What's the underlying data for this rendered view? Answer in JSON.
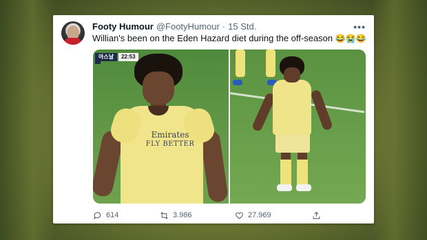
{
  "tweet": {
    "display_name": "Footy Humour",
    "handle": "@FootyHumour",
    "separator": "·",
    "time": "15 Std.",
    "more_label": "•••",
    "text": "Willian's been on the Eden Hazard diet during the off-season",
    "emojis": "😂😭😂"
  },
  "media": {
    "scorebug_team": "아스날",
    "scorebug_clock": "22:53",
    "sponsor_line1": "Emirates",
    "sponsor_line2": "FLY BETTER"
  },
  "actions": {
    "replies": "614",
    "retweets": "3.986",
    "likes": "27.969"
  },
  "icons": {
    "reply": "reply-icon",
    "retweet": "retweet-icon",
    "like": "heart-icon",
    "share": "share-icon"
  },
  "colors": {
    "text_primary": "#0f1419",
    "text_secondary": "#536471",
    "kit_yellow": "#f0e58a"
  }
}
